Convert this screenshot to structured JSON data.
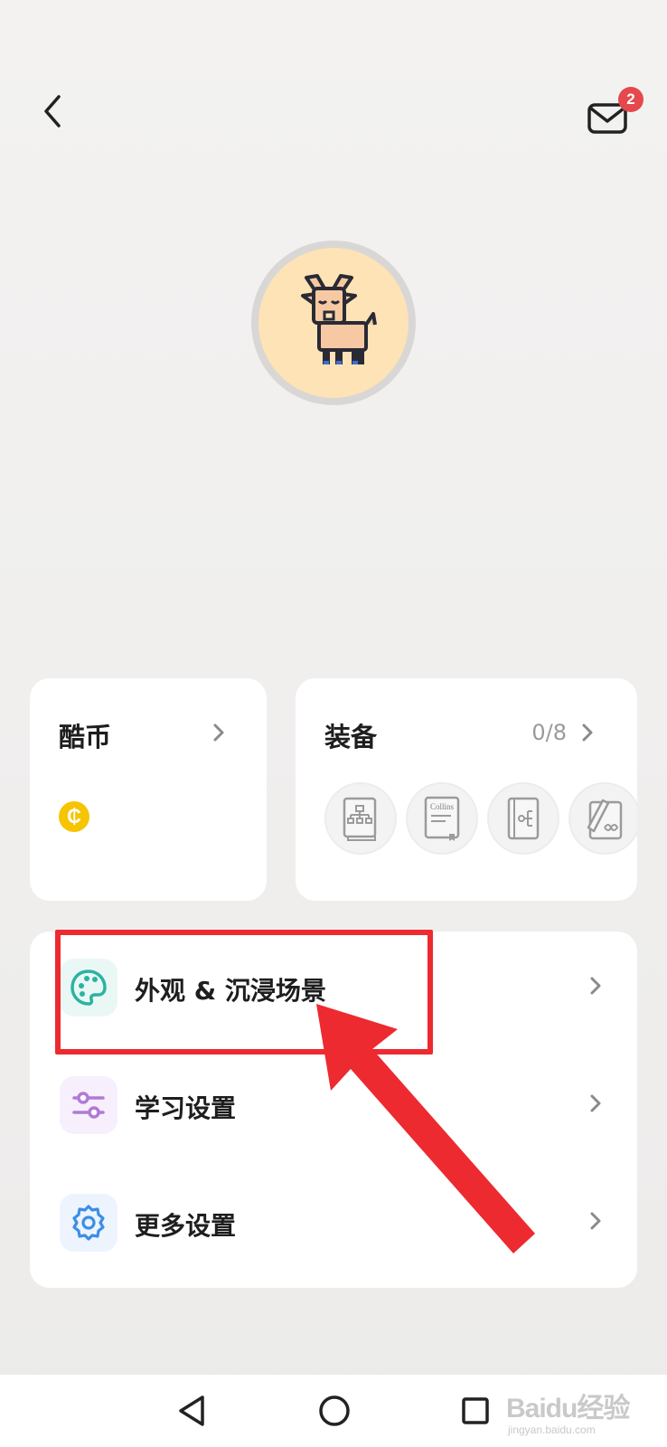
{
  "header": {
    "back_icon": "chevron-left-icon",
    "mail_icon": "mail-icon",
    "mail_badge_count": "2"
  },
  "avatar": {
    "icon": "goat-avatar-icon",
    "background_color": "#fde3b5"
  },
  "coins_card": {
    "title": "酷币",
    "coin_symbol": "₵",
    "coin_color": "#f6c400"
  },
  "equipment_card": {
    "title": "装备",
    "count": "0/8",
    "items": [
      {
        "icon": "mindmap-book-icon"
      },
      {
        "icon": "collins-dictionary-icon",
        "label": "Collins"
      },
      {
        "icon": "tree-book-icon"
      },
      {
        "icon": "pencil-book-icon"
      }
    ]
  },
  "settings": {
    "items": [
      {
        "label": "外观 & 沉浸场景",
        "icon": "palette-icon",
        "icon_color": "#2bb3a0"
      },
      {
        "label": "学习设置",
        "icon": "sliders-icon",
        "icon_color": "#b07ad8"
      },
      {
        "label": "更多设置",
        "icon": "gear-icon",
        "icon_color": "#3b8ee8"
      }
    ]
  },
  "annotation": {
    "highlight_color": "#ec2a30"
  },
  "navbar": {
    "back_icon": "nav-back-icon",
    "home_icon": "nav-home-icon",
    "recent_icon": "nav-recent-icon"
  },
  "watermark": {
    "main": "Baidu经验",
    "sub": "jingyan.baidu.com"
  }
}
